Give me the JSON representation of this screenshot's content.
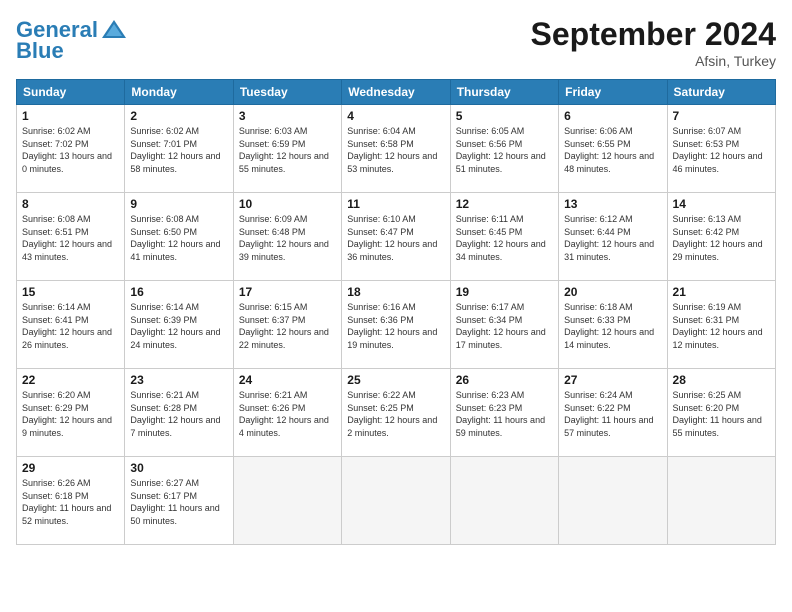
{
  "header": {
    "logo_general": "General",
    "logo_blue": "Blue",
    "month_title": "September 2024",
    "location": "Afsin, Turkey"
  },
  "days_of_week": [
    "Sunday",
    "Monday",
    "Tuesday",
    "Wednesday",
    "Thursday",
    "Friday",
    "Saturday"
  ],
  "weeks": [
    [
      {
        "day": 1,
        "sunrise": "6:02 AM",
        "sunset": "7:02 PM",
        "daylight": "13 hours and 0 minutes."
      },
      {
        "day": 2,
        "sunrise": "6:02 AM",
        "sunset": "7:01 PM",
        "daylight": "12 hours and 58 minutes."
      },
      {
        "day": 3,
        "sunrise": "6:03 AM",
        "sunset": "6:59 PM",
        "daylight": "12 hours and 55 minutes."
      },
      {
        "day": 4,
        "sunrise": "6:04 AM",
        "sunset": "6:58 PM",
        "daylight": "12 hours and 53 minutes."
      },
      {
        "day": 5,
        "sunrise": "6:05 AM",
        "sunset": "6:56 PM",
        "daylight": "12 hours and 51 minutes."
      },
      {
        "day": 6,
        "sunrise": "6:06 AM",
        "sunset": "6:55 PM",
        "daylight": "12 hours and 48 minutes."
      },
      {
        "day": 7,
        "sunrise": "6:07 AM",
        "sunset": "6:53 PM",
        "daylight": "12 hours and 46 minutes."
      }
    ],
    [
      {
        "day": 8,
        "sunrise": "6:08 AM",
        "sunset": "6:51 PM",
        "daylight": "12 hours and 43 minutes."
      },
      {
        "day": 9,
        "sunrise": "6:08 AM",
        "sunset": "6:50 PM",
        "daylight": "12 hours and 41 minutes."
      },
      {
        "day": 10,
        "sunrise": "6:09 AM",
        "sunset": "6:48 PM",
        "daylight": "12 hours and 39 minutes."
      },
      {
        "day": 11,
        "sunrise": "6:10 AM",
        "sunset": "6:47 PM",
        "daylight": "12 hours and 36 minutes."
      },
      {
        "day": 12,
        "sunrise": "6:11 AM",
        "sunset": "6:45 PM",
        "daylight": "12 hours and 34 minutes."
      },
      {
        "day": 13,
        "sunrise": "6:12 AM",
        "sunset": "6:44 PM",
        "daylight": "12 hours and 31 minutes."
      },
      {
        "day": 14,
        "sunrise": "6:13 AM",
        "sunset": "6:42 PM",
        "daylight": "12 hours and 29 minutes."
      }
    ],
    [
      {
        "day": 15,
        "sunrise": "6:14 AM",
        "sunset": "6:41 PM",
        "daylight": "12 hours and 26 minutes."
      },
      {
        "day": 16,
        "sunrise": "6:14 AM",
        "sunset": "6:39 PM",
        "daylight": "12 hours and 24 minutes."
      },
      {
        "day": 17,
        "sunrise": "6:15 AM",
        "sunset": "6:37 PM",
        "daylight": "12 hours and 22 minutes."
      },
      {
        "day": 18,
        "sunrise": "6:16 AM",
        "sunset": "6:36 PM",
        "daylight": "12 hours and 19 minutes."
      },
      {
        "day": 19,
        "sunrise": "6:17 AM",
        "sunset": "6:34 PM",
        "daylight": "12 hours and 17 minutes."
      },
      {
        "day": 20,
        "sunrise": "6:18 AM",
        "sunset": "6:33 PM",
        "daylight": "12 hours and 14 minutes."
      },
      {
        "day": 21,
        "sunrise": "6:19 AM",
        "sunset": "6:31 PM",
        "daylight": "12 hours and 12 minutes."
      }
    ],
    [
      {
        "day": 22,
        "sunrise": "6:20 AM",
        "sunset": "6:29 PM",
        "daylight": "12 hours and 9 minutes."
      },
      {
        "day": 23,
        "sunrise": "6:21 AM",
        "sunset": "6:28 PM",
        "daylight": "12 hours and 7 minutes."
      },
      {
        "day": 24,
        "sunrise": "6:21 AM",
        "sunset": "6:26 PM",
        "daylight": "12 hours and 4 minutes."
      },
      {
        "day": 25,
        "sunrise": "6:22 AM",
        "sunset": "6:25 PM",
        "daylight": "12 hours and 2 minutes."
      },
      {
        "day": 26,
        "sunrise": "6:23 AM",
        "sunset": "6:23 PM",
        "daylight": "11 hours and 59 minutes."
      },
      {
        "day": 27,
        "sunrise": "6:24 AM",
        "sunset": "6:22 PM",
        "daylight": "11 hours and 57 minutes."
      },
      {
        "day": 28,
        "sunrise": "6:25 AM",
        "sunset": "6:20 PM",
        "daylight": "11 hours and 55 minutes."
      }
    ],
    [
      {
        "day": 29,
        "sunrise": "6:26 AM",
        "sunset": "6:18 PM",
        "daylight": "11 hours and 52 minutes."
      },
      {
        "day": 30,
        "sunrise": "6:27 AM",
        "sunset": "6:17 PM",
        "daylight": "11 hours and 50 minutes."
      },
      null,
      null,
      null,
      null,
      null
    ]
  ]
}
